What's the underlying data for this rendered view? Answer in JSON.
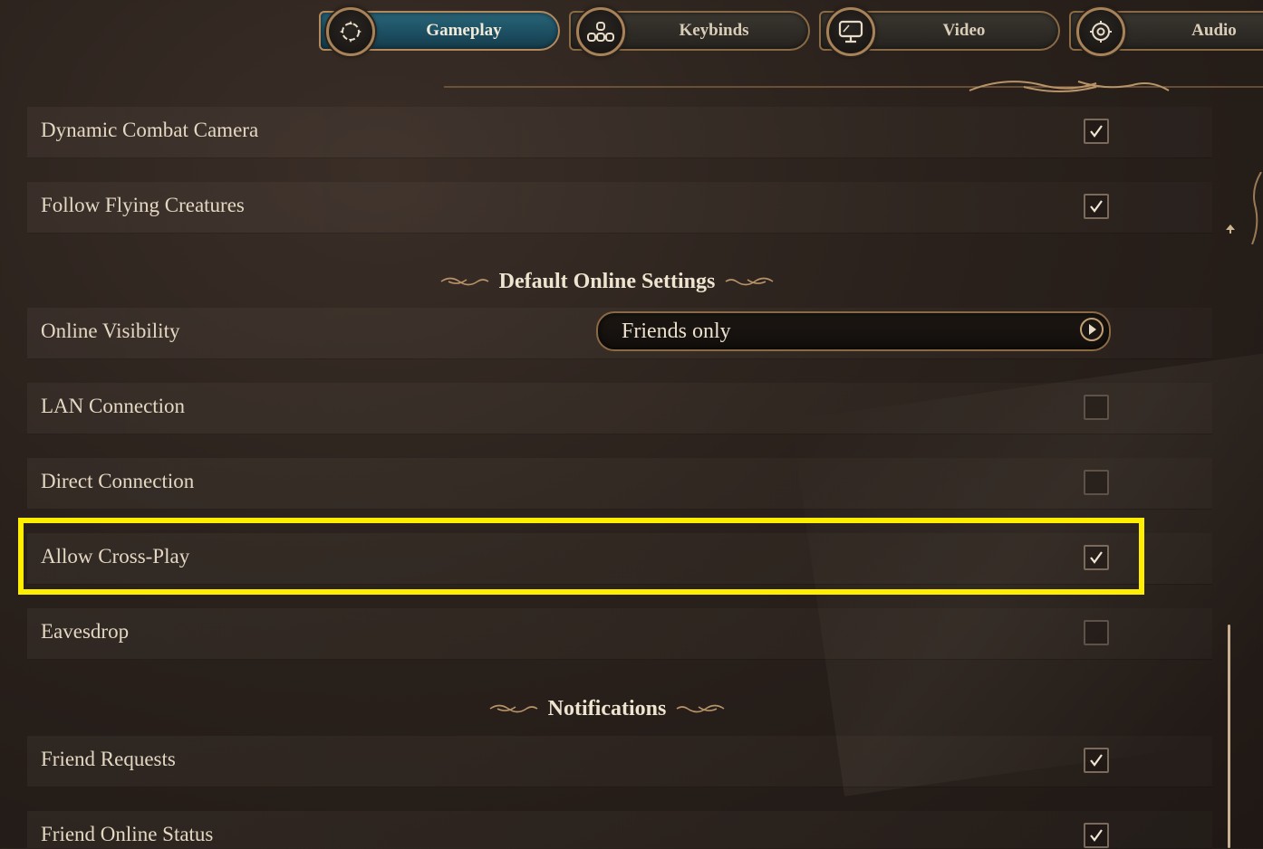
{
  "tabs": [
    {
      "label": "Gameplay",
      "icon": "gameplay-icon",
      "active": true
    },
    {
      "label": "Keybinds",
      "icon": "keybinds-icon",
      "active": false
    },
    {
      "label": "Video",
      "icon": "monitor-icon",
      "active": false
    },
    {
      "label": "Audio",
      "icon": "audio-icon",
      "active": false
    }
  ],
  "settings": {
    "dynamic_combat_camera": {
      "label": "Dynamic Combat Camera",
      "checked": true
    },
    "follow_flying_creatures": {
      "label": "Follow Flying Creatures",
      "checked": true
    },
    "online_section_title": "Default Online Settings",
    "online_visibility": {
      "label": "Online Visibility",
      "value": "Friends only"
    },
    "lan_connection": {
      "label": "LAN Connection",
      "checked": false
    },
    "direct_connection": {
      "label": "Direct Connection",
      "checked": false
    },
    "allow_cross_play": {
      "label": "Allow Cross-Play",
      "checked": true
    },
    "eavesdrop": {
      "label": "Eavesdrop",
      "checked": false
    },
    "notifications_section_title": "Notifications",
    "friend_requests": {
      "label": "Friend Requests",
      "checked": true
    },
    "friend_online_status": {
      "label": "Friend Online Status",
      "checked": true
    }
  },
  "colors": {
    "highlight": "#ffee00",
    "active_tab": "#1c4f62",
    "gold_border": "#8a6a45"
  }
}
